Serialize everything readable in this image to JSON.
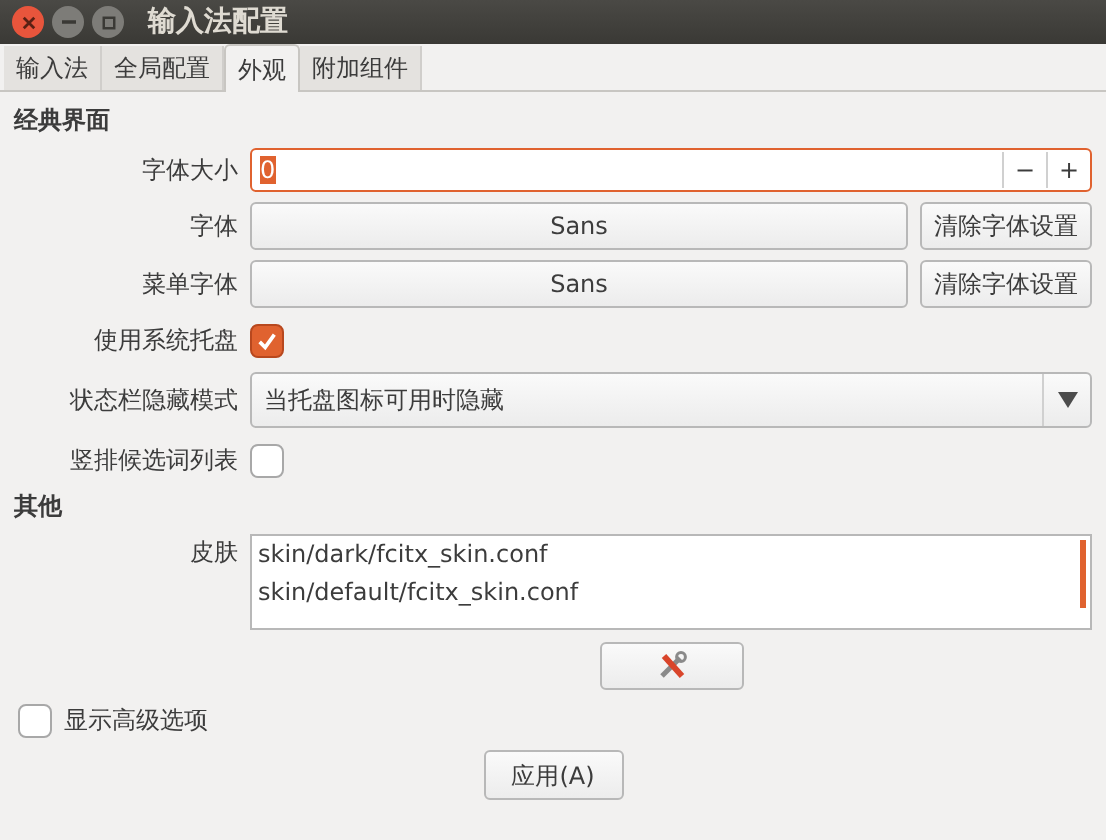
{
  "window": {
    "title": "输入法配置"
  },
  "tabs": [
    {
      "label": "输入法",
      "selected": false
    },
    {
      "label": "全局配置",
      "selected": false
    },
    {
      "label": "外观",
      "selected": true
    },
    {
      "label": "附加组件",
      "selected": false
    }
  ],
  "sections": [
    {
      "title": "经典界面",
      "rows": [
        {
          "kind": "spin",
          "label": "字体大小",
          "value": "0",
          "minus": "−",
          "plus": "+"
        },
        {
          "kind": "font",
          "label": "字体",
          "value": "Sans",
          "button": "清除字体设置"
        },
        {
          "kind": "font",
          "label": "菜单字体",
          "value": "Sans",
          "button": "清除字体设置"
        },
        {
          "kind": "check",
          "label": "使用系统托盘",
          "checked": true
        },
        {
          "kind": "combo",
          "label": "状态栏隐藏模式",
          "value": "当托盘图标可用时隐藏"
        },
        {
          "kind": "check",
          "label": "竖排候选词列表",
          "checked": false
        }
      ]
    },
    {
      "title": "其他",
      "rows": [
        {
          "kind": "list",
          "label": "皮肤",
          "items": [
            "skin/dark/fcitx_skin.conf",
            "skin/default/fcitx_skin.conf"
          ]
        }
      ]
    }
  ],
  "advanced": {
    "label": "显示高级选项",
    "checked": false
  },
  "apply_button": "应用(A)"
}
